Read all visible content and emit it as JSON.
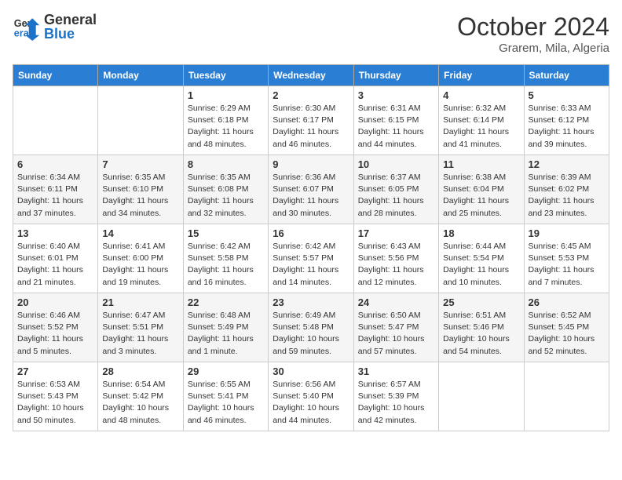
{
  "header": {
    "logo": {
      "general": "General",
      "blue": "Blue"
    },
    "title": "October 2024",
    "location": "Grarem, Mila, Algeria"
  },
  "days_of_week": [
    "Sunday",
    "Monday",
    "Tuesday",
    "Wednesday",
    "Thursday",
    "Friday",
    "Saturday"
  ],
  "weeks": [
    [
      null,
      null,
      {
        "day": 1,
        "sunrise": "6:29 AM",
        "sunset": "6:18 PM",
        "daylight": "11 hours and 48 minutes."
      },
      {
        "day": 2,
        "sunrise": "6:30 AM",
        "sunset": "6:17 PM",
        "daylight": "11 hours and 46 minutes."
      },
      {
        "day": 3,
        "sunrise": "6:31 AM",
        "sunset": "6:15 PM",
        "daylight": "11 hours and 44 minutes."
      },
      {
        "day": 4,
        "sunrise": "6:32 AM",
        "sunset": "6:14 PM",
        "daylight": "11 hours and 41 minutes."
      },
      {
        "day": 5,
        "sunrise": "6:33 AM",
        "sunset": "6:12 PM",
        "daylight": "11 hours and 39 minutes."
      }
    ],
    [
      {
        "day": 6,
        "sunrise": "6:34 AM",
        "sunset": "6:11 PM",
        "daylight": "11 hours and 37 minutes."
      },
      {
        "day": 7,
        "sunrise": "6:35 AM",
        "sunset": "6:10 PM",
        "daylight": "11 hours and 34 minutes."
      },
      {
        "day": 8,
        "sunrise": "6:35 AM",
        "sunset": "6:08 PM",
        "daylight": "11 hours and 32 minutes."
      },
      {
        "day": 9,
        "sunrise": "6:36 AM",
        "sunset": "6:07 PM",
        "daylight": "11 hours and 30 minutes."
      },
      {
        "day": 10,
        "sunrise": "6:37 AM",
        "sunset": "6:05 PM",
        "daylight": "11 hours and 28 minutes."
      },
      {
        "day": 11,
        "sunrise": "6:38 AM",
        "sunset": "6:04 PM",
        "daylight": "11 hours and 25 minutes."
      },
      {
        "day": 12,
        "sunrise": "6:39 AM",
        "sunset": "6:02 PM",
        "daylight": "11 hours and 23 minutes."
      }
    ],
    [
      {
        "day": 13,
        "sunrise": "6:40 AM",
        "sunset": "6:01 PM",
        "daylight": "11 hours and 21 minutes."
      },
      {
        "day": 14,
        "sunrise": "6:41 AM",
        "sunset": "6:00 PM",
        "daylight": "11 hours and 19 minutes."
      },
      {
        "day": 15,
        "sunrise": "6:42 AM",
        "sunset": "5:58 PM",
        "daylight": "11 hours and 16 minutes."
      },
      {
        "day": 16,
        "sunrise": "6:42 AM",
        "sunset": "5:57 PM",
        "daylight": "11 hours and 14 minutes."
      },
      {
        "day": 17,
        "sunrise": "6:43 AM",
        "sunset": "5:56 PM",
        "daylight": "11 hours and 12 minutes."
      },
      {
        "day": 18,
        "sunrise": "6:44 AM",
        "sunset": "5:54 PM",
        "daylight": "11 hours and 10 minutes."
      },
      {
        "day": 19,
        "sunrise": "6:45 AM",
        "sunset": "5:53 PM",
        "daylight": "11 hours and 7 minutes."
      }
    ],
    [
      {
        "day": 20,
        "sunrise": "6:46 AM",
        "sunset": "5:52 PM",
        "daylight": "11 hours and 5 minutes."
      },
      {
        "day": 21,
        "sunrise": "6:47 AM",
        "sunset": "5:51 PM",
        "daylight": "11 hours and 3 minutes."
      },
      {
        "day": 22,
        "sunrise": "6:48 AM",
        "sunset": "5:49 PM",
        "daylight": "11 hours and 1 minute."
      },
      {
        "day": 23,
        "sunrise": "6:49 AM",
        "sunset": "5:48 PM",
        "daylight": "10 hours and 59 minutes."
      },
      {
        "day": 24,
        "sunrise": "6:50 AM",
        "sunset": "5:47 PM",
        "daylight": "10 hours and 57 minutes."
      },
      {
        "day": 25,
        "sunrise": "6:51 AM",
        "sunset": "5:46 PM",
        "daylight": "10 hours and 54 minutes."
      },
      {
        "day": 26,
        "sunrise": "6:52 AM",
        "sunset": "5:45 PM",
        "daylight": "10 hours and 52 minutes."
      }
    ],
    [
      {
        "day": 27,
        "sunrise": "6:53 AM",
        "sunset": "5:43 PM",
        "daylight": "10 hours and 50 minutes."
      },
      {
        "day": 28,
        "sunrise": "6:54 AM",
        "sunset": "5:42 PM",
        "daylight": "10 hours and 48 minutes."
      },
      {
        "day": 29,
        "sunrise": "6:55 AM",
        "sunset": "5:41 PM",
        "daylight": "10 hours and 46 minutes."
      },
      {
        "day": 30,
        "sunrise": "6:56 AM",
        "sunset": "5:40 PM",
        "daylight": "10 hours and 44 minutes."
      },
      {
        "day": 31,
        "sunrise": "6:57 AM",
        "sunset": "5:39 PM",
        "daylight": "10 hours and 42 minutes."
      },
      null,
      null
    ]
  ]
}
